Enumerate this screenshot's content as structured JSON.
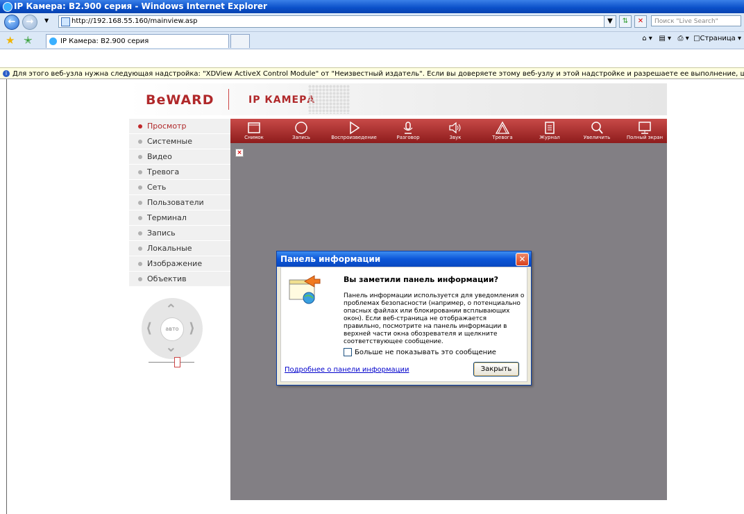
{
  "window": {
    "title": "IP Камера: B2.900 серия - Windows Internet Explorer"
  },
  "addressbar": {
    "url": "http://192.168.55.160/mainview.asp",
    "search_placeholder": "Поиск \"Live Search\""
  },
  "tabs": [
    {
      "label": "IP Камера: B2.900 серия"
    },
    {
      "label": ""
    }
  ],
  "tools": {
    "page_label": "Страница"
  },
  "infobar": {
    "text": "Для этого веб-узла нужна следующая надстройка: \"XDView ActiveX Control Module\" от \"Неизвестный издатель\". Если вы доверяете этому веб-узлу и этой надстройке и разрешаете ее выполнение, щелкните здесь..."
  },
  "header": {
    "logo": "BeWARD",
    "title": "IP КАМЕРА"
  },
  "menu": [
    {
      "label": "Просмотр",
      "active": true
    },
    {
      "label": "Системные"
    },
    {
      "label": "Видео"
    },
    {
      "label": "Тревога"
    },
    {
      "label": "Сеть"
    },
    {
      "label": "Пользователи"
    },
    {
      "label": "Терминал"
    },
    {
      "label": "Запись"
    },
    {
      "label": "Локальные"
    },
    {
      "label": "Изображение"
    },
    {
      "label": "Объектив"
    }
  ],
  "ptz": {
    "auto_label": "авто"
  },
  "toolbar": [
    {
      "label": "Снимок",
      "icon": "snapshot-icon"
    },
    {
      "label": "Запись",
      "icon": "record-icon"
    },
    {
      "label": "Воспроизведение",
      "icon": "play-icon"
    },
    {
      "label": "Разговор",
      "icon": "microphone-icon"
    },
    {
      "label": "Звук",
      "icon": "speaker-icon"
    },
    {
      "label": "Тревога",
      "icon": "alarm-icon"
    },
    {
      "label": "Журнал",
      "icon": "log-icon"
    },
    {
      "label": "Увеличить",
      "icon": "zoom-icon"
    },
    {
      "label": "Полный экран",
      "icon": "fullscreen-icon"
    }
  ],
  "dialog": {
    "title": "Панель информации",
    "question": "Вы заметили панель информации?",
    "text": "Панель информации используется для уведомления о проблемах безопасности (например, о потенциально опасных файлах или блокировании всплывающих окон). Если веб-страница не отображается правильно, посмотрите на панель информации в верхней части окна обозревателя и щелкните соответствующее сообщение.",
    "checkbox_label": "Больше не показывать это сообщение",
    "link_label": "Подробнее о панели информации",
    "close_label": "Закрыть"
  },
  "colors": {
    "brand": "#b0282a",
    "toolbar": "#a83232",
    "video_bg": "#827f84"
  }
}
